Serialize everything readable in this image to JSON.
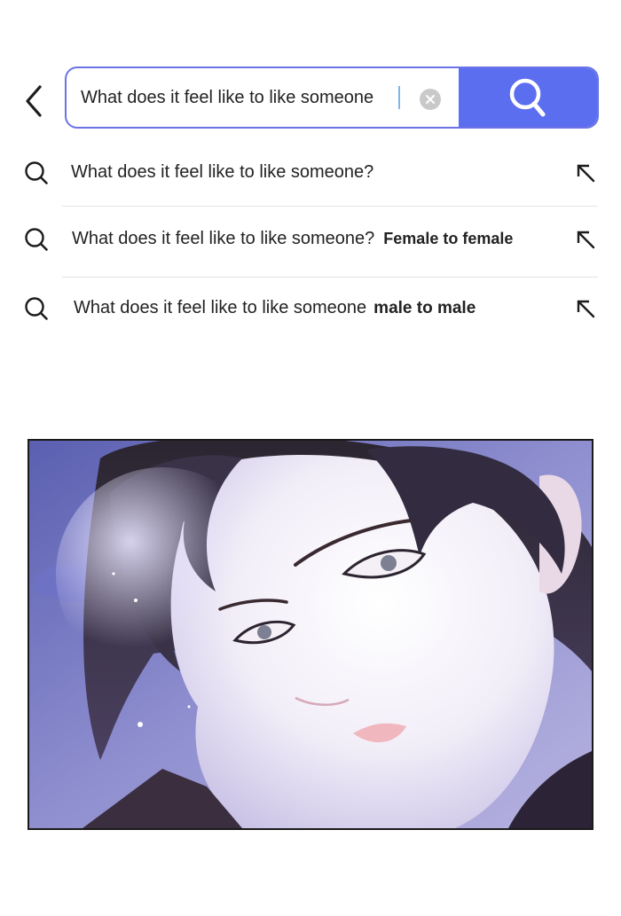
{
  "search": {
    "query": "What does it feel like to like someone",
    "search_label": "Search"
  },
  "suggestions": [
    {
      "text": "What does it feel like to like someone?",
      "bold": ""
    },
    {
      "text": "What does it feel like to like someone?",
      "bold": "Female to female"
    },
    {
      "text": "What does it feel like to like someone",
      "bold": "male to male"
    }
  ],
  "icons": {
    "back": "chevron-left-icon",
    "clear": "clear-icon",
    "search": "search-icon",
    "suggestion": "search-icon",
    "fill": "arrow-up-left-icon"
  },
  "colors": {
    "accent": "#5c6ef0",
    "border": "#6b73e6",
    "clear": "#c9c9c9"
  }
}
